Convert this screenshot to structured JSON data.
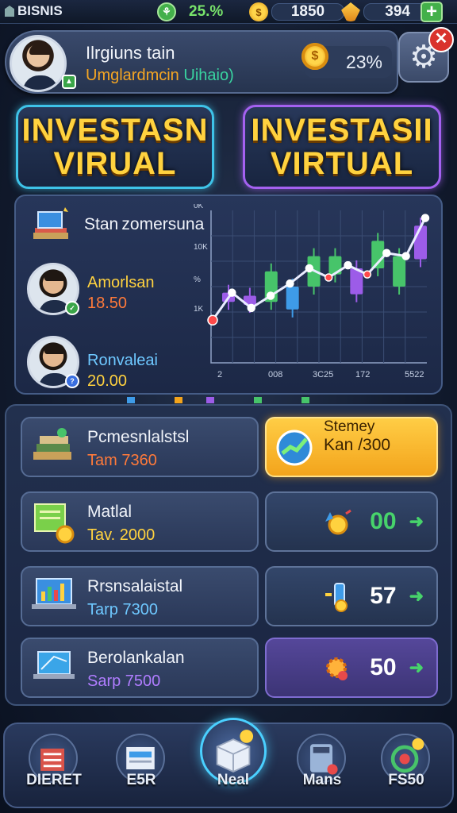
{
  "topbar": {
    "brand": "BISNIS",
    "growth": "25.%",
    "coins": "1850",
    "gems": "394",
    "add_icon": "plus-icon"
  },
  "profile": {
    "name": "Ilrgiuns tain",
    "subtitle_a": "Umglardmcin",
    "subtitle_b": "Uihaio)",
    "percent": "23%",
    "settings_icon": "gear-icon",
    "close_icon": "close-icon"
  },
  "mode_buttons": [
    {
      "line1": "INVESTASN",
      "line2": "VIRUAL"
    },
    {
      "line1": "INVESTASII",
      "line2": "VIRTUAL"
    }
  ],
  "overview": {
    "category_label": "Stan zomersuna",
    "investors": [
      {
        "name": "Amorlsan",
        "value": "18.50",
        "name_color": "#ffd23f",
        "value_color": "#ff7a3a"
      },
      {
        "name": "Ronvaleai",
        "value": "20.00",
        "name_color": "#6ec8ff",
        "value_color": "#ffd23f"
      }
    ]
  },
  "chart_data": {
    "type": "candlestick",
    "ytick_labels": [
      "0K",
      "10K",
      "%",
      "1K"
    ],
    "xtick_labels": [
      "2",
      "008",
      "3C25",
      "172",
      "5522"
    ],
    "candles": [
      {
        "open": 40,
        "close": 46,
        "color": "#9c5ce8"
      },
      {
        "open": 44,
        "close": 38,
        "color": "#9c5ce8"
      },
      {
        "open": 40,
        "close": 60,
        "color": "#47c46a"
      },
      {
        "open": 35,
        "close": 50,
        "color": "#3e9be8"
      },
      {
        "open": 50,
        "close": 70,
        "color": "#47c46a"
      },
      {
        "open": 58,
        "close": 70,
        "color": "#47c46a"
      },
      {
        "open": 45,
        "close": 62,
        "color": "#9c5ce8"
      },
      {
        "open": 62,
        "close": 80,
        "color": "#47c46a"
      },
      {
        "open": 50,
        "close": 70,
        "color": "#47c46a"
      },
      {
        "open": 68,
        "close": 90,
        "color": "#9c5ce8"
      }
    ],
    "line": [
      28,
      46,
      36,
      44,
      52,
      62,
      56,
      64,
      58,
      72,
      70,
      95
    ]
  },
  "investments": [
    {
      "title": "Pcmesnlalstsl",
      "subtitle": "Tam 7360",
      "sub_color": "#ff7a3a",
      "icon": "books-stack-icon",
      "action": {
        "style": "orange",
        "line1": "Stemey",
        "line2": "Kan /300",
        "icon": "growth-chart-icon"
      }
    },
    {
      "title": "Matlal",
      "subtitle": "Tav. 2000",
      "sub_color": "#ffd23f",
      "icon": "certificate-coin-icon",
      "action": {
        "style": "blue",
        "value": "00",
        "value_color": "#47d36b",
        "icon": "coin-rocket-icon",
        "arrow": "➔"
      }
    },
    {
      "title": "Rrsnsalaistal",
      "subtitle": "Tarp 7300",
      "sub_color": "#6ec8ff",
      "icon": "laptop-chart-icon",
      "action": {
        "style": "blue",
        "value": "57",
        "value_color": "#ffffff",
        "icon": "battery-coin-icon",
        "arrow": "➔"
      }
    },
    {
      "title": "Berolankalan",
      "subtitle": "Sarp 7500",
      "sub_color": "#b07dff",
      "icon": "laptop-icon",
      "action": {
        "style": "purple",
        "value": "50",
        "value_color": "#ffffff",
        "icon": "gear-coin-icon",
        "arrow": "➔"
      }
    }
  ],
  "nav": [
    {
      "label": "DIERET",
      "icon": "building-icon"
    },
    {
      "label": "E5R",
      "icon": "document-stack-icon"
    },
    {
      "label": "Neal",
      "icon": "box-icon"
    },
    {
      "label": "Mans",
      "icon": "calculator-icon"
    },
    {
      "label": "FS50",
      "icon": "target-coin-icon"
    }
  ]
}
